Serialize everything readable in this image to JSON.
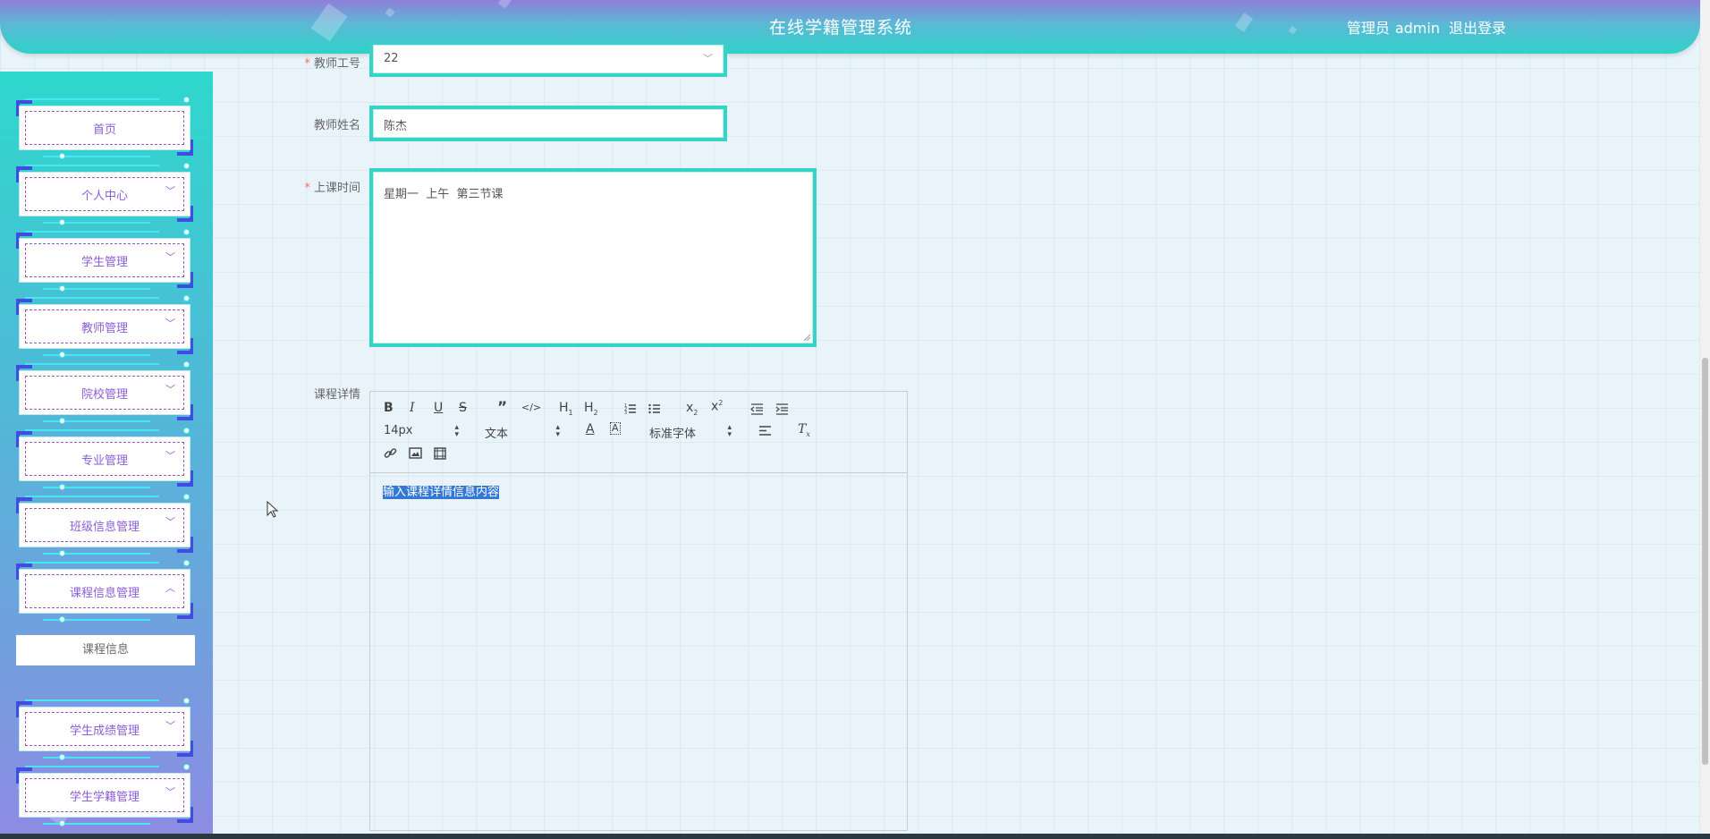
{
  "header": {
    "title": "在线学籍管理系统",
    "user_role": "管理员",
    "username": "admin",
    "logout_label": "退出登录"
  },
  "sidebar": {
    "items": [
      {
        "label": "首页",
        "has_arrow": false
      },
      {
        "label": "个人中心",
        "has_arrow": true,
        "expanded": false
      },
      {
        "label": "学生管理",
        "has_arrow": true,
        "expanded": false
      },
      {
        "label": "教师管理",
        "has_arrow": true,
        "expanded": false
      },
      {
        "label": "院校管理",
        "has_arrow": true,
        "expanded": false
      },
      {
        "label": "专业管理",
        "has_arrow": true,
        "expanded": false
      },
      {
        "label": "班级信息管理",
        "has_arrow": true,
        "expanded": false
      },
      {
        "label": "课程信息管理",
        "has_arrow": true,
        "expanded": true
      },
      {
        "label": "学生成绩管理",
        "has_arrow": true,
        "expanded": false
      },
      {
        "label": "学生学籍管理",
        "has_arrow": true,
        "expanded": false
      }
    ],
    "sub_item_label": "课程信息"
  },
  "form": {
    "teacher_id": {
      "label": "教师工号",
      "required": true,
      "value": "22"
    },
    "teacher_name": {
      "label": "教师姓名",
      "required": false,
      "value": "陈杰"
    },
    "class_time": {
      "label": "上课时间",
      "required": true,
      "value": "星期一  上午  第三节课"
    },
    "course_detail": {
      "label": "课程详情",
      "font_size": "14px",
      "block_type": "文本",
      "font_family": "标准字体",
      "content": "输入课程详情信息内容"
    }
  },
  "colors": {
    "accent": "#37d3c6",
    "menu_text": "#8c5ed9",
    "required": "#f56c6c",
    "selection": "#3478d6"
  }
}
